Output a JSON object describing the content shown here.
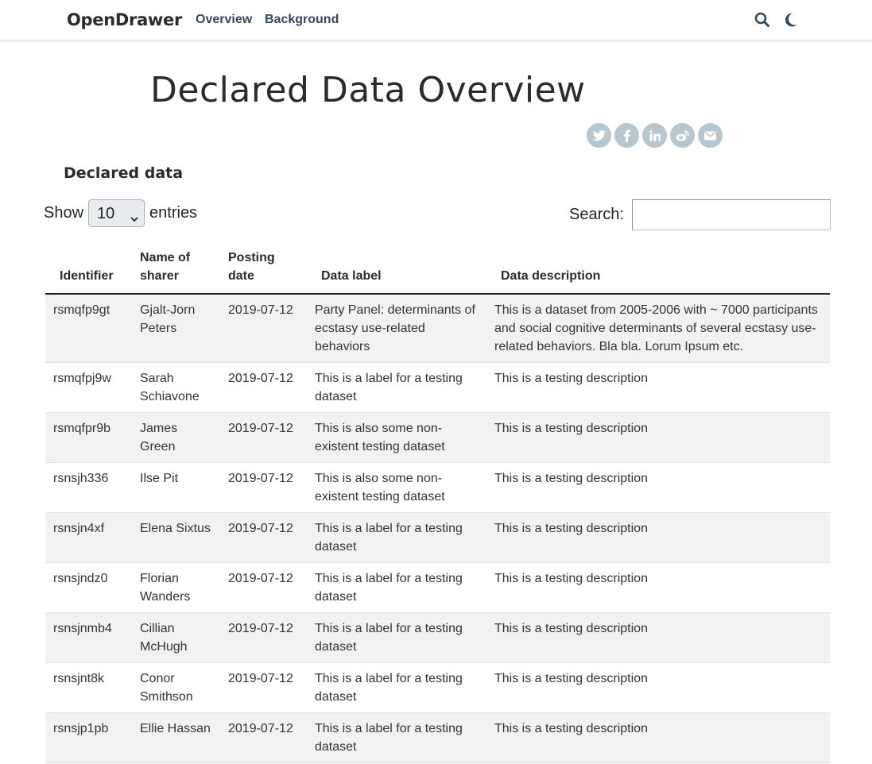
{
  "nav": {
    "brand": "OpenDrawer",
    "links": [
      "Overview",
      "Background"
    ],
    "icons": [
      "search-icon",
      "moon-icon"
    ]
  },
  "page": {
    "title": "Declared Data Overview"
  },
  "share": [
    "twitter-icon",
    "facebook-icon",
    "linkedin-icon",
    "weibo-icon",
    "email-icon"
  ],
  "section": {
    "title": "Declared data"
  },
  "controls": {
    "show_label": "Show",
    "entries_label": "entries",
    "page_length": "10",
    "search_label": "Search:",
    "search_value": ""
  },
  "table": {
    "headers": [
      "Identifier",
      "Name of sharer",
      "Posting date",
      "Data label",
      "Data description"
    ],
    "rows": [
      [
        "rsmqfp9gt",
        "Gjalt-Jorn Peters",
        "2019-07-12",
        "Party Panel: determinants of ecstasy use-related behaviors",
        "This is a dataset from 2005-2006 with ~ 7000 participants and social cognitive determinants of several ecstasy use-related behaviors. Bla bla. Lorum Ipsum etc."
      ],
      [
        "rsmqfpj9w",
        "Sarah Schiavone",
        "2019-07-12",
        "This is a label for a testing dataset",
        "This is a testing description"
      ],
      [
        "rsmqfpr9b",
        "James Green",
        "2019-07-12",
        "This is also some non-existent testing dataset",
        "This is a testing description"
      ],
      [
        "rsnsjh336",
        "Ilse Pit",
        "2019-07-12",
        "This is also some non-existent testing dataset",
        "This is a testing description"
      ],
      [
        "rsnsjn4xf",
        "Elena Sixtus",
        "2019-07-12",
        "This is a label for a testing dataset",
        "This is a testing description"
      ],
      [
        "rsnsjndz0",
        "Florian Wanders",
        "2019-07-12",
        "This is a label for a testing dataset",
        "This is a testing description"
      ],
      [
        "rsnsjnmb4",
        "Cillian McHugh",
        "2019-07-12",
        "This is a label for a testing dataset",
        "This is a testing description"
      ],
      [
        "rsnsjnt8k",
        "Conor Smithson",
        "2019-07-12",
        "This is a label for a testing dataset",
        "This is a testing description"
      ],
      [
        "rsnsjp1pb",
        "Ellie Hassan",
        "2019-07-12",
        "This is a label for a testing dataset",
        "This is a testing description"
      ]
    ]
  },
  "colors": {
    "nav_link": "#34495e",
    "share_bg": "#b8c6cf",
    "row_stripe": "#f2f2f2"
  }
}
